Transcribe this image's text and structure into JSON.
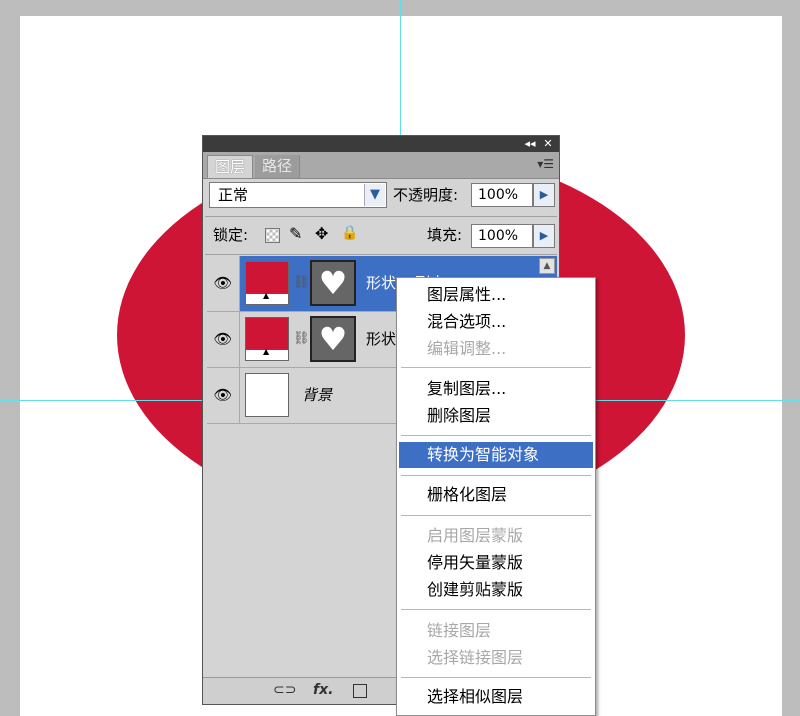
{
  "panel": {
    "tabs": [
      "图层",
      "路径"
    ],
    "titlebar": {
      "collapse": "◂◂",
      "close": "✕"
    },
    "menu_icon": "panel-menu-icon",
    "blend_mode": "正常",
    "opacity_label": "不透明度:",
    "opacity_value": "100%",
    "lock_label": "锁定:",
    "fill_label": "填充:",
    "fill_value": "100%",
    "layers": [
      {
        "name": "形状 1 副本",
        "selected": true
      },
      {
        "name": "形状 1",
        "selected": false
      },
      {
        "name": "背景",
        "selected": false
      }
    ]
  },
  "context_menu": {
    "items": [
      {
        "label": "图层属性...",
        "disabled": false
      },
      {
        "label": "混合选项...",
        "disabled": false
      },
      {
        "label": "编辑调整...",
        "disabled": true
      },
      {
        "label": "复制图层...",
        "disabled": false
      },
      {
        "label": "删除图层",
        "disabled": false
      },
      {
        "label": "转换为智能对象",
        "disabled": false,
        "highlighted": true
      },
      {
        "label": "栅格化图层",
        "disabled": false
      },
      {
        "label": "启用图层蒙版",
        "disabled": true
      },
      {
        "label": "停用矢量蒙版",
        "disabled": false
      },
      {
        "label": "创建剪贴蒙版",
        "disabled": false
      },
      {
        "label": "链接图层",
        "disabled": true
      },
      {
        "label": "选择链接图层",
        "disabled": true
      },
      {
        "label": "选择相似图层",
        "disabled": false
      }
    ]
  },
  "colors": {
    "shape_red": "#cf1535",
    "selection_blue": "#3d6fc5",
    "guide_cyan": "#5fe0ea"
  }
}
